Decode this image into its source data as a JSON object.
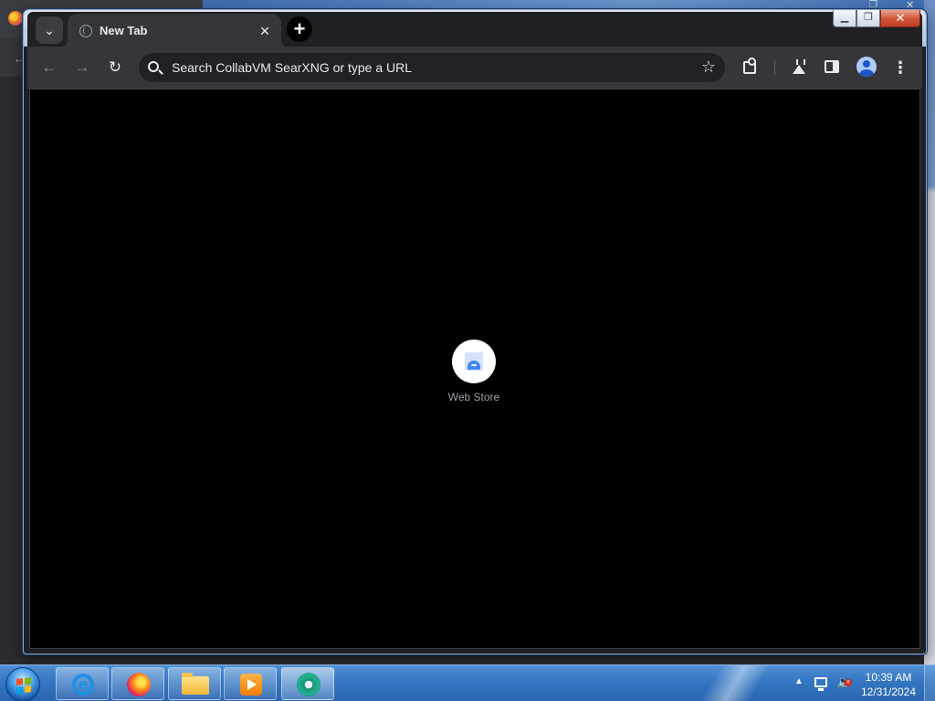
{
  "browser": {
    "tab": {
      "title": "New Tab"
    },
    "omnibox": {
      "placeholder": "Search CollabVM SearXNG or type a URL"
    },
    "shortcuts": [
      {
        "label": "Web Store"
      }
    ]
  },
  "taskbar": {
    "clock": {
      "time": "10:39 AM",
      "date": "12/31/2024"
    }
  }
}
